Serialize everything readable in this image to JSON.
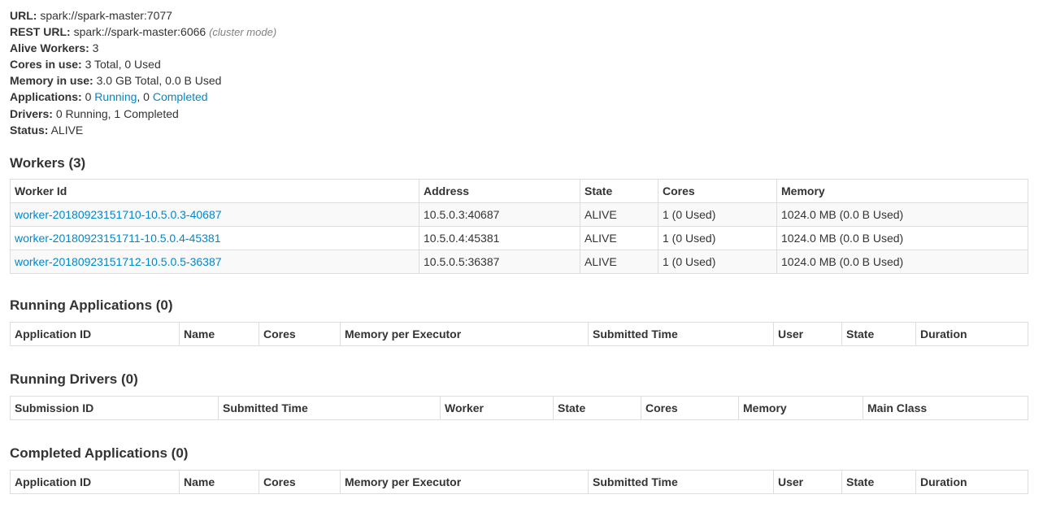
{
  "summary": {
    "url_label": "URL:",
    "url_value": "spark://spark-master:7077",
    "rest_url_label": "REST URL:",
    "rest_url_value": "spark://spark-master:6066",
    "rest_url_note": "(cluster mode)",
    "alive_workers_label": "Alive Workers:",
    "alive_workers_value": "3",
    "cores_label": "Cores in use:",
    "cores_value": "3 Total, 0 Used",
    "memory_label": "Memory in use:",
    "memory_value": "3.0 GB Total, 0.0 B Used",
    "applications_label": "Applications:",
    "applications_running_count": "0",
    "applications_running_link": "Running",
    "applications_separator": ", 0",
    "applications_completed_link": "Completed",
    "drivers_label": "Drivers:",
    "drivers_value": "0 Running, 1 Completed",
    "status_label": "Status:",
    "status_value": "ALIVE"
  },
  "workers": {
    "heading": "Workers (3)",
    "columns": [
      "Worker Id",
      "Address",
      "State",
      "Cores",
      "Memory"
    ],
    "rows": [
      {
        "id": "worker-20180923151710-10.5.0.3-40687",
        "address": "10.5.0.3:40687",
        "state": "ALIVE",
        "cores": "1 (0 Used)",
        "memory": "1024.0 MB (0.0 B Used)"
      },
      {
        "id": "worker-20180923151711-10.5.0.4-45381",
        "address": "10.5.0.4:45381",
        "state": "ALIVE",
        "cores": "1 (0 Used)",
        "memory": "1024.0 MB (0.0 B Used)"
      },
      {
        "id": "worker-20180923151712-10.5.0.5-36387",
        "address": "10.5.0.5:36387",
        "state": "ALIVE",
        "cores": "1 (0 Used)",
        "memory": "1024.0 MB (0.0 B Used)"
      }
    ]
  },
  "running_applications": {
    "heading": "Running Applications (0)",
    "columns": [
      "Application ID",
      "Name",
      "Cores",
      "Memory per Executor",
      "Submitted Time",
      "User",
      "State",
      "Duration"
    ]
  },
  "running_drivers": {
    "heading": "Running Drivers (0)",
    "columns": [
      "Submission ID",
      "Submitted Time",
      "Worker",
      "State",
      "Cores",
      "Memory",
      "Main Class"
    ]
  },
  "completed_applications": {
    "heading": "Completed Applications (0)",
    "columns": [
      "Application ID",
      "Name",
      "Cores",
      "Memory per Executor",
      "Submitted Time",
      "User",
      "State",
      "Duration"
    ]
  },
  "colors": {
    "link": "#0088cc",
    "text": "#333333",
    "border": "#dddddd",
    "stripe": "#f9f9f9"
  }
}
